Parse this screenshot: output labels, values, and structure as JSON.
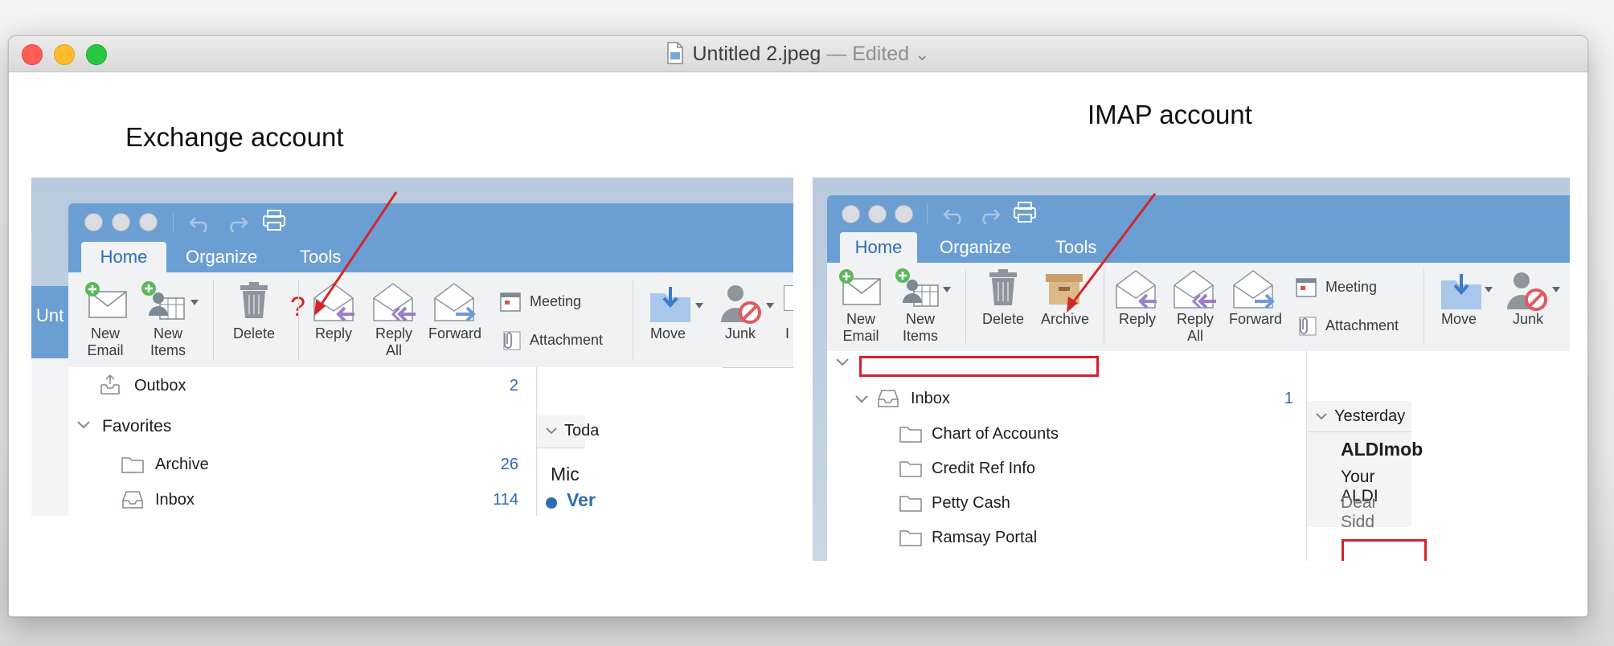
{
  "window": {
    "file_name": "Untitled 2.jpeg",
    "separator": " — ",
    "status": "Edited",
    "status_chevron": "⌄"
  },
  "annotations": {
    "left_label": "Exchange account",
    "right_label": "IMAP account",
    "question_mark": "?",
    "arrow_color": "#d3262b"
  },
  "colors": {
    "outlook_blue": "#6b9fd3",
    "ribbon_bg": "#f1f2f4",
    "link_blue": "#2d6cb3",
    "highlight_red": "#d3212c"
  },
  "left": {
    "tabs": [
      "Home",
      "Organize",
      "Tools"
    ],
    "ribbon": {
      "new_email": [
        "New",
        "Email"
      ],
      "new_items": [
        "New",
        "Items"
      ],
      "delete": "Delete",
      "reply": "Reply",
      "reply_all": [
        "Reply",
        "All"
      ],
      "forward": "Forward",
      "meeting": "Meeting",
      "attachment": "Attachment",
      "move": "Move",
      "junk": "Junk",
      "partial_label": "I"
    },
    "bg_window_title": "Unt",
    "folders": [
      {
        "name": "Outbox",
        "count": "2",
        "icon": "outbox-icon"
      },
      {
        "name": "Favorites",
        "count": "",
        "icon": "chevron-down-icon"
      },
      {
        "name": "Archive",
        "count": "26",
        "icon": "folder-icon"
      },
      {
        "name": "Inbox",
        "count": "114",
        "icon": "inbox-icon"
      }
    ],
    "list": {
      "group": "Toda",
      "sender": "Mic",
      "subject": "Ver"
    }
  },
  "right": {
    "tabs": [
      "Home",
      "Organize",
      "Tools"
    ],
    "ribbon": {
      "new_email": [
        "New",
        "Email"
      ],
      "new_items": [
        "New",
        "Items"
      ],
      "delete": "Delete",
      "archive": "Archive",
      "reply": "Reply",
      "reply_all": [
        "Reply",
        "All"
      ],
      "forward": "Forward",
      "meeting": "Meeting",
      "attachment": "Attachment",
      "move": "Move",
      "junk": "Junk"
    },
    "inbox": {
      "name": "Inbox",
      "count": "1"
    },
    "folders": [
      "Chart of Accounts",
      "Credit Ref Info",
      "Petty Cash",
      "Ramsay Portal"
    ],
    "list": {
      "group": "Yesterday",
      "sender": "ALDImob",
      "subject": "Your ALDI",
      "preview": "Dear Sidd"
    }
  }
}
